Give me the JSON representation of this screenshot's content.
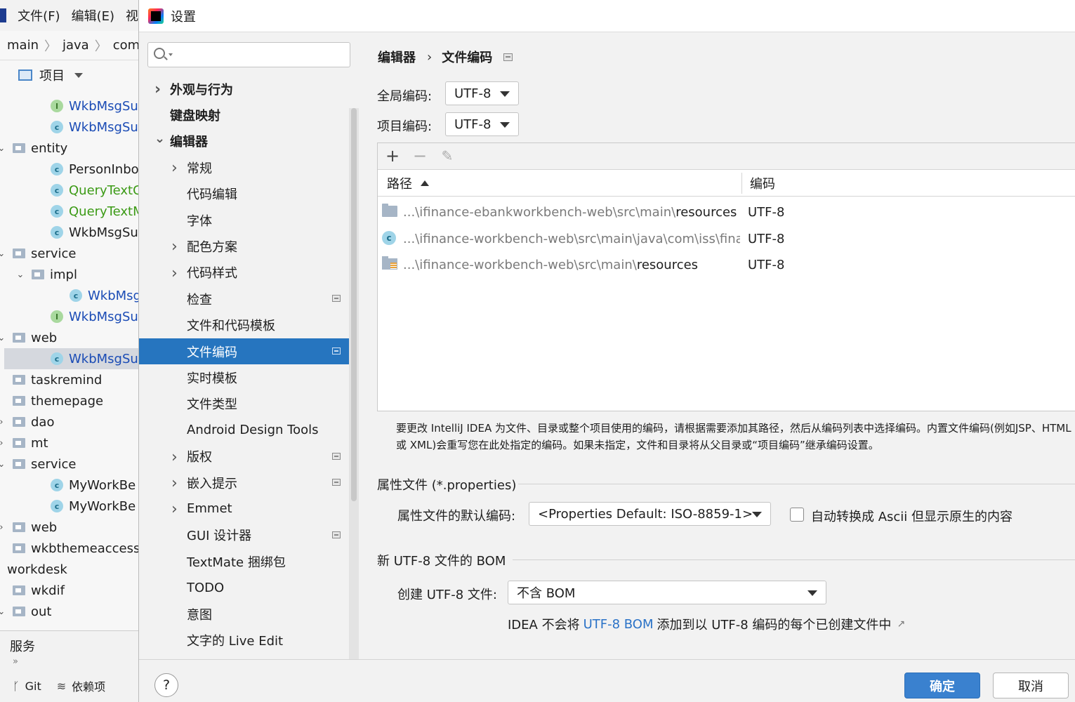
{
  "ide": {
    "menu": [
      "文件(F)",
      "编辑(E)",
      "视"
    ],
    "breadcrumb": [
      "main",
      "java",
      "com"
    ],
    "project_label": "项目",
    "tree": [
      {
        "label": "WkbMsgSu",
        "kind": "interface",
        "color": "blue"
      },
      {
        "label": "WkbMsgSu",
        "kind": "class",
        "color": "blue"
      },
      {
        "label": "entity",
        "kind": "folder",
        "arrow": "down"
      },
      {
        "label": "PersonInbo",
        "kind": "class",
        "color": "default"
      },
      {
        "label": "QueryTextC",
        "kind": "class",
        "color": "green"
      },
      {
        "label": "QueryTextM",
        "kind": "class",
        "color": "green"
      },
      {
        "label": "WkbMsgSu",
        "kind": "class",
        "color": "default"
      },
      {
        "label": "service",
        "kind": "folder",
        "arrow": "down"
      },
      {
        "label": "impl",
        "kind": "folder",
        "arrow": "down"
      },
      {
        "label": "WkbMsg",
        "kind": "class",
        "color": "blue"
      },
      {
        "label": "WkbMsgSu",
        "kind": "interface",
        "color": "blue"
      },
      {
        "label": "web",
        "kind": "folder",
        "arrow": "down"
      },
      {
        "label": "WkbMsgSu",
        "kind": "class",
        "color": "blue",
        "selected": true
      },
      {
        "label": "taskremind",
        "kind": "folder"
      },
      {
        "label": "themepage",
        "kind": "folder"
      },
      {
        "label": "dao",
        "kind": "folder",
        "arrow": "right"
      },
      {
        "label": "mt",
        "kind": "folder",
        "arrow": "right"
      },
      {
        "label": "service",
        "kind": "folder",
        "arrow": "down"
      },
      {
        "label": "MyWorkBe",
        "kind": "class",
        "color": "default"
      },
      {
        "label": "MyWorkBe",
        "kind": "class",
        "color": "default"
      },
      {
        "label": "web",
        "kind": "folder",
        "arrow": "right"
      },
      {
        "label": "wkbthemeaccess",
        "kind": "folder"
      },
      {
        "label": "workdesk",
        "kind": "none"
      },
      {
        "label": "wkdif",
        "kind": "folder"
      },
      {
        "label": "out",
        "kind": "folder",
        "arrow": "down"
      }
    ],
    "services_label": "服务",
    "status": {
      "git": "Git",
      "deps": "依赖项"
    }
  },
  "dialog": {
    "title": "设置",
    "search": {
      "placeholder": "",
      "value": ""
    },
    "nav": [
      {
        "label": "外观与行为",
        "arrow": "right",
        "bold": true,
        "level": 0
      },
      {
        "label": "键盘映射",
        "arrow": "",
        "bold": true,
        "level": 0
      },
      {
        "label": "编辑器",
        "arrow": "down",
        "bold": true,
        "level": 0
      },
      {
        "label": "常规",
        "arrow": "right",
        "level": 1
      },
      {
        "label": "代码编辑",
        "arrow": "",
        "level": 1
      },
      {
        "label": "字体",
        "arrow": "",
        "level": 1
      },
      {
        "label": "配色方案",
        "arrow": "right",
        "level": 1
      },
      {
        "label": "代码样式",
        "arrow": "right",
        "level": 1
      },
      {
        "label": "检查",
        "arrow": "",
        "level": 1,
        "project": true
      },
      {
        "label": "文件和代码模板",
        "arrow": "",
        "level": 1
      },
      {
        "label": "文件编码",
        "arrow": "",
        "level": 1,
        "project": true,
        "selected": true
      },
      {
        "label": "实时模板",
        "arrow": "",
        "level": 1
      },
      {
        "label": "文件类型",
        "arrow": "",
        "level": 1
      },
      {
        "label": "Android Design Tools",
        "arrow": "",
        "level": 1
      },
      {
        "label": "版权",
        "arrow": "right",
        "level": 1,
        "project": true
      },
      {
        "label": "嵌入提示",
        "arrow": "right",
        "level": 1,
        "project": true
      },
      {
        "label": "Emmet",
        "arrow": "right",
        "level": 1
      },
      {
        "label": "GUI 设计器",
        "arrow": "",
        "level": 1,
        "project": true
      },
      {
        "label": "TextMate 捆绑包",
        "arrow": "",
        "level": 1
      },
      {
        "label": "TODO",
        "arrow": "",
        "level": 1
      },
      {
        "label": "意图",
        "arrow": "",
        "level": 1
      },
      {
        "label": "文字的 Live Edit",
        "arrow": "",
        "level": 1
      }
    ],
    "breadcrumb": {
      "parent": "编辑器",
      "sep": "›",
      "current": "文件编码"
    },
    "global_encoding": {
      "label": "全局编码:",
      "value": "UTF-8"
    },
    "project_encoding": {
      "label": "项目编码:",
      "value": "UTF-8"
    },
    "toolbar": {
      "add": "+",
      "remove": "−",
      "edit": "✎"
    },
    "table": {
      "col_path": "路径",
      "col_encoding": "编码",
      "rows": [
        {
          "icon": "folder",
          "path_prefix": "...\\ifinance-ebankworkbench-web\\src\\main\\",
          "path_tail": "resources",
          "encoding": "UTF-8"
        },
        {
          "icon": "class",
          "path_prefix": "...\\ifinance-workbench-web\\src\\main\\java\\com\\iss\\financ",
          "path_tail": "",
          "encoding": "UTF-8"
        },
        {
          "icon": "resources",
          "path_prefix": "...\\ifinance-workbench-web\\src\\main\\",
          "path_tail": "resources",
          "encoding": "UTF-8"
        }
      ]
    },
    "hint": "要更改 IntelliJ IDEA 为文件、目录或整个项目使用的编码，请根据需要添加其路径，然后从编码列表中选择编码。内置文件编码(例如JSP、HTML 或 XML)会重写您在此处指定的编码。如果未指定，文件和目录将从父目录或“项目编码”继承编码设置。",
    "properties": {
      "group_title": "属性文件 (*.properties)",
      "default_label": "属性文件的默认编码:",
      "default_value": "<Properties Default: ISO-8859-1>",
      "ascii_label": "自动转换成 Ascii 但显示原生的内容",
      "ascii_checked": false
    },
    "bom": {
      "group_title": "新 UTF-8 文件的 BOM",
      "create_label": "创建 UTF-8 文件:",
      "create_value": "不含 BOM",
      "note_prefix": "IDEA 不会将",
      "note_link": "UTF-8 BOM",
      "note_suffix": "添加到以 UTF-8 编码的每个已创建文件中",
      "note_ext": "↗"
    },
    "buttons": {
      "help": "?",
      "ok": "确定",
      "cancel": "取消"
    }
  }
}
